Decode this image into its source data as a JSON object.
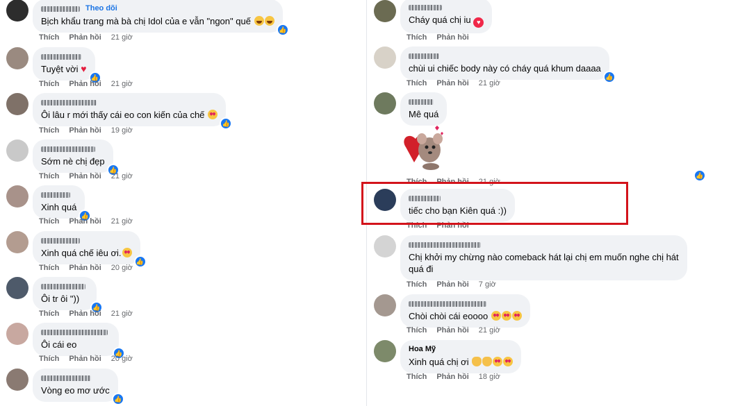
{
  "labels": {
    "like": "Thích",
    "reply": "Phản hồi"
  },
  "left_comments": [
    {
      "name": "",
      "follow": "Theo dõi",
      "text": "Bịch khẩu trang mà bà chị Idol của e vẫn \"ngon\" quế",
      "time": "21 giờ"
    },
    {
      "name": "",
      "text": "Tuyệt vời",
      "time": "21 giờ"
    },
    {
      "name": "",
      "text": "Ôi lâu r mới thấy cái eo con kiến của chế",
      "time": "19 giờ"
    },
    {
      "name": "",
      "text": "Sớm nè chị đẹp",
      "time": "21 giờ"
    },
    {
      "name": "",
      "text": "Xinh quá",
      "time": "21 giờ"
    },
    {
      "name": "",
      "text": "Xinh quá chế iêu ơi.",
      "time": "20 giờ"
    },
    {
      "name": "",
      "text": "Ôi tr ôi \"))",
      "time": "21 giờ"
    },
    {
      "name": "",
      "text": "Ôi cái eo",
      "time": "20 giờ"
    },
    {
      "name": "",
      "text": "Vòng eo mơ ước",
      "time": ""
    }
  ],
  "right_comments": [
    {
      "name": "",
      "text": "Cháy quá chị iu",
      "time": ""
    },
    {
      "name": "",
      "text": "chùi ui chiếc body này có cháy quá khum daaaa",
      "time": "21 giờ"
    },
    {
      "name": "",
      "text": "Mê quá",
      "time": "21 giờ"
    },
    {
      "name": "",
      "text": "tiếc cho bạn Kiên quá :))",
      "time": ""
    },
    {
      "name": "",
      "text": "Chị khởi my chừng nào comeback hát lại chị em muốn nghe chị hát",
      "text2": "quá đi",
      "time": "7 giờ"
    },
    {
      "name": "",
      "text": "Chòi chòi cái eoooo",
      "time": "21 giờ"
    },
    {
      "name": "Hoa Mỹ",
      "text": "Xinh quá chị ơi",
      "time": "18 giờ"
    }
  ],
  "colors": {
    "accent": "#1877f2",
    "highlight": "#d3131b",
    "bubble": "#f0f2f5",
    "meta": "#65676b"
  },
  "icons": {
    "reaction": "like-reaction-icon",
    "sticker": "heart-mouse-sticker"
  }
}
